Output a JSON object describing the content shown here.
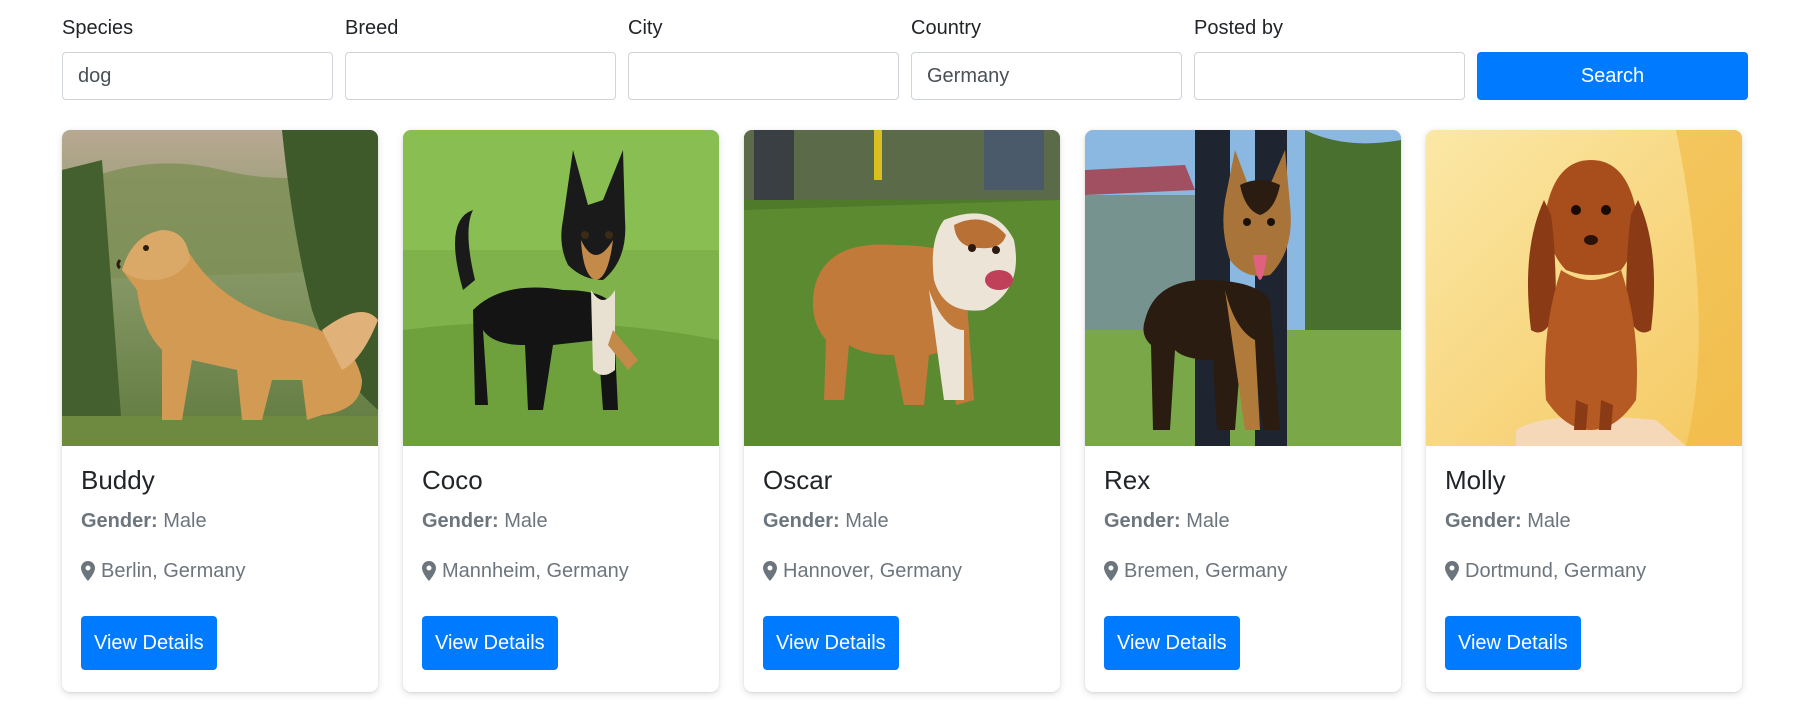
{
  "search": {
    "fields": [
      {
        "label": "Species",
        "value": "dog"
      },
      {
        "label": "Breed",
        "value": ""
      },
      {
        "label": "City",
        "value": ""
      },
      {
        "label": "Country",
        "value": "Germany"
      },
      {
        "label": "Posted by",
        "value": ""
      }
    ],
    "button_label": "Search"
  },
  "pets": [
    {
      "name": "Buddy",
      "gender_label": "Gender:",
      "gender": "Male",
      "location": "Berlin, Germany",
      "button_label": "View Details",
      "photo": "golden-retriever-photo"
    },
    {
      "name": "Coco",
      "gender_label": "Gender:",
      "gender": "Male",
      "location": "Mannheim, Germany",
      "button_label": "View Details",
      "photo": "chihuahua-photo"
    },
    {
      "name": "Oscar",
      "gender_label": "Gender:",
      "gender": "Male",
      "location": "Hannover, Germany",
      "button_label": "View Details",
      "photo": "bulldog-photo"
    },
    {
      "name": "Rex",
      "gender_label": "Gender:",
      "gender": "Male",
      "location": "Bremen, Germany",
      "button_label": "View Details",
      "photo": "german-shepherd-photo"
    },
    {
      "name": "Molly",
      "gender_label": "Gender:",
      "gender": "Male",
      "location": "Dortmund, Germany",
      "button_label": "View Details",
      "photo": "dachshund-photo"
    }
  ],
  "colors": {
    "accent": "#007bff",
    "muted_text": "#6c757d"
  }
}
